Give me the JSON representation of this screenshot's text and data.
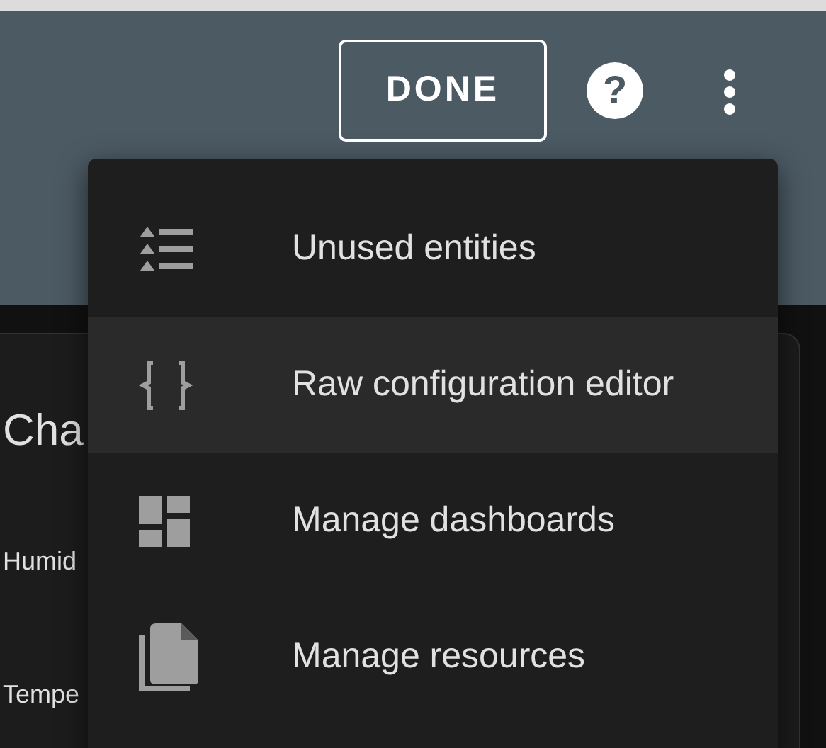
{
  "toolbar": {
    "done_button": "DONE",
    "help_button": "?"
  },
  "card": {
    "title": "Cha",
    "rows": [
      "Humid",
      "Tempe"
    ]
  },
  "menu": {
    "items": [
      {
        "label": "Unused entities",
        "selected": false
      },
      {
        "label": "Raw configuration editor",
        "selected": true
      },
      {
        "label": "Manage dashboards",
        "selected": false
      },
      {
        "label": "Manage resources",
        "selected": false
      }
    ]
  }
}
